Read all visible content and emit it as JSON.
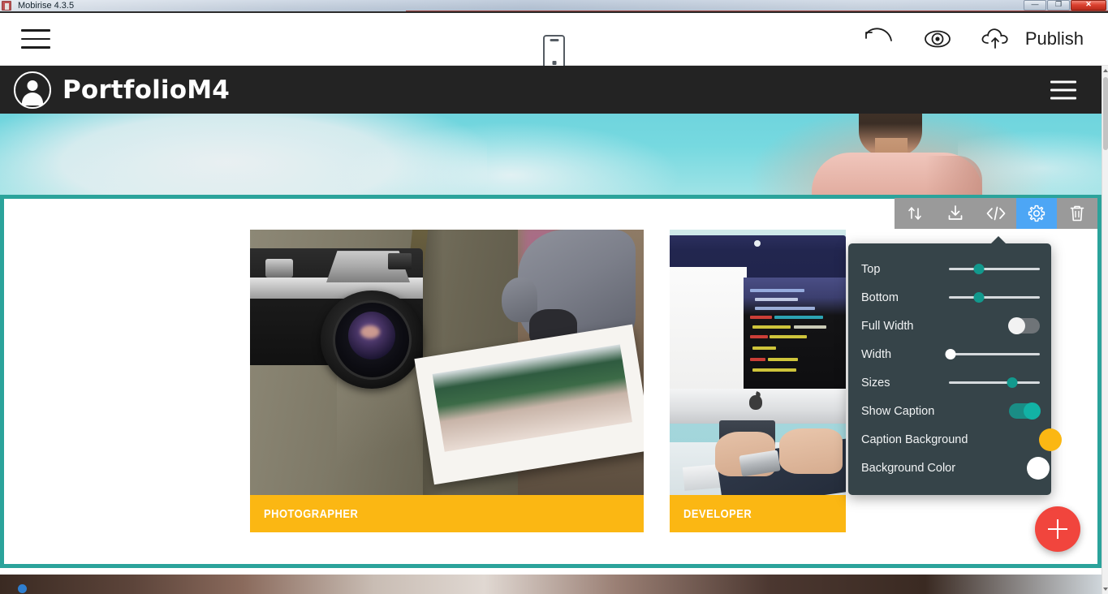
{
  "window": {
    "title": "Mobirise 4.3.5",
    "controls": {
      "minimize": "—",
      "maximize": "❐",
      "close": "✕"
    }
  },
  "app_toolbar": {
    "menu_icon": "hamburger-menu-icon",
    "device_icon": "mobile-device-icon",
    "undo_icon": "undo-arrow-icon",
    "preview_icon": "eye-preview-icon",
    "publish_icon": "cloud-upload-icon",
    "publish_label": "Publish"
  },
  "site_header": {
    "brand": "PortfolioM4",
    "brand_icon": "user-avatar-circle-icon",
    "menu_icon": "hamburger-menu-icon",
    "background": "#232323"
  },
  "block_toolbar": {
    "buttons": [
      {
        "name": "move-block-button",
        "icon": "up-down-arrows-icon",
        "active": false
      },
      {
        "name": "import-block-button",
        "icon": "download-arrow-icon",
        "active": false
      },
      {
        "name": "edit-code-button",
        "icon": "code-brackets-icon",
        "active": false
      },
      {
        "name": "block-settings-button",
        "icon": "gear-icon",
        "active": true
      },
      {
        "name": "delete-block-button",
        "icon": "trash-can-icon",
        "active": false
      }
    ],
    "active_color": "#4da6f5",
    "background": "#9a9a9a"
  },
  "settings_panel": {
    "background": "#364449",
    "accent": "#12998d",
    "rows": [
      {
        "label": "Top",
        "type": "slider",
        "value": 33
      },
      {
        "label": "Bottom",
        "type": "slider",
        "value": 33
      },
      {
        "label": "Full Width",
        "type": "toggle",
        "value": "off"
      },
      {
        "label": "Width",
        "type": "slider",
        "value": 0,
        "knob": "white"
      },
      {
        "label": "Sizes",
        "type": "slider",
        "value": 72
      },
      {
        "label": "Show Caption",
        "type": "toggle",
        "value": "on"
      },
      {
        "label": "Caption Background",
        "type": "color",
        "value": "#fbb713"
      },
      {
        "label": "Background Color",
        "type": "color",
        "value": "#ffffff"
      }
    ]
  },
  "gallery": {
    "selection_color": "#2ba39b",
    "caption_background": "#fbb713",
    "items": [
      {
        "caption": "PHOTOGRAPHER",
        "image": "vintage-camera-and-photo-print"
      },
      {
        "caption": "DEVELOPER",
        "image": "imac-with-code-editor-and-hands-on-keyboard"
      }
    ]
  },
  "add_block": {
    "icon": "plus-icon",
    "color": "#f1453d"
  }
}
